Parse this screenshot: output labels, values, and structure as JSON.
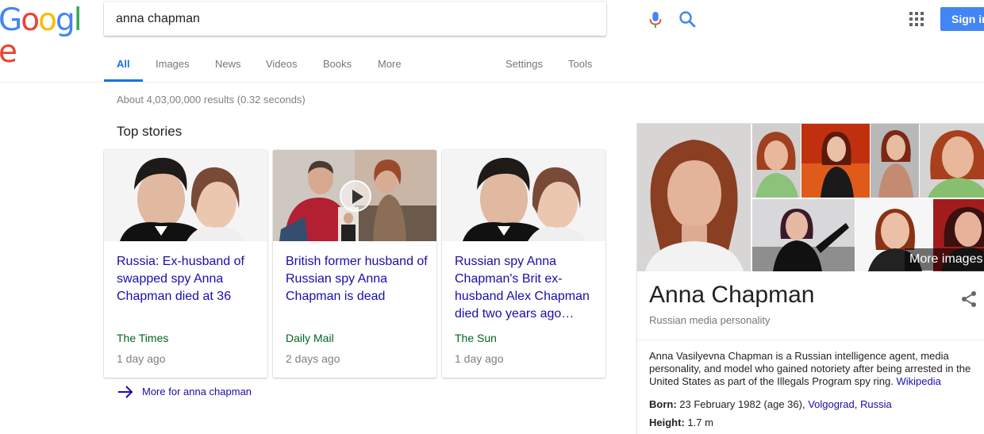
{
  "header": {
    "logo": {
      "letters": [
        "G",
        "o",
        "o",
        "g",
        "l",
        "e"
      ]
    },
    "search": {
      "value": "anna chapman",
      "placeholder": ""
    },
    "sign_in": "Sign in"
  },
  "tabs": {
    "all": "All",
    "images": "Images",
    "news": "News",
    "videos": "Videos",
    "books": "Books",
    "more": "More",
    "settings": "Settings",
    "tools": "Tools"
  },
  "results_stats": "About 4,03,00,000 results (0.32 seconds)",
  "top_stories": {
    "heading": "Top stories",
    "cards": [
      {
        "title": "Russia: Ex-husband of swapped spy Anna Chapman died at 36",
        "source": "The Times",
        "age": "1 day ago"
      },
      {
        "title": "British former husband of Russian spy Anna Chapman is dead",
        "source": "Daily Mail",
        "age": "2 days ago"
      },
      {
        "title": "Russian spy Anna Chapman's Brit ex-husband Alex Chapman died two years ago…",
        "source": "The Sun",
        "age": "1 day ago"
      }
    ],
    "more_link": "More for anna chapman"
  },
  "knowledge_panel": {
    "more_images": "More images",
    "title": "Anna Chapman",
    "subtitle": "Russian media personality",
    "description": "Anna Vasilyevna Chapman is a Russian intelligence agent, media personality, and model who gained notoriety after being arrested in the United States as part of the Illegals Program spy ring.",
    "wiki_link": "Wikipedia",
    "born_label": "Born:",
    "born_value": "23 February 1982 (age 36),",
    "born_place_city": "Volgograd",
    "born_place_sep": ",",
    "born_place_country": "Russia",
    "height_label": "Height:",
    "height_value": "1.7 m"
  },
  "colors": {
    "accent": "#1a73e8",
    "link": "#1a0dab",
    "source_green": "#006621",
    "muted": "#808080"
  }
}
